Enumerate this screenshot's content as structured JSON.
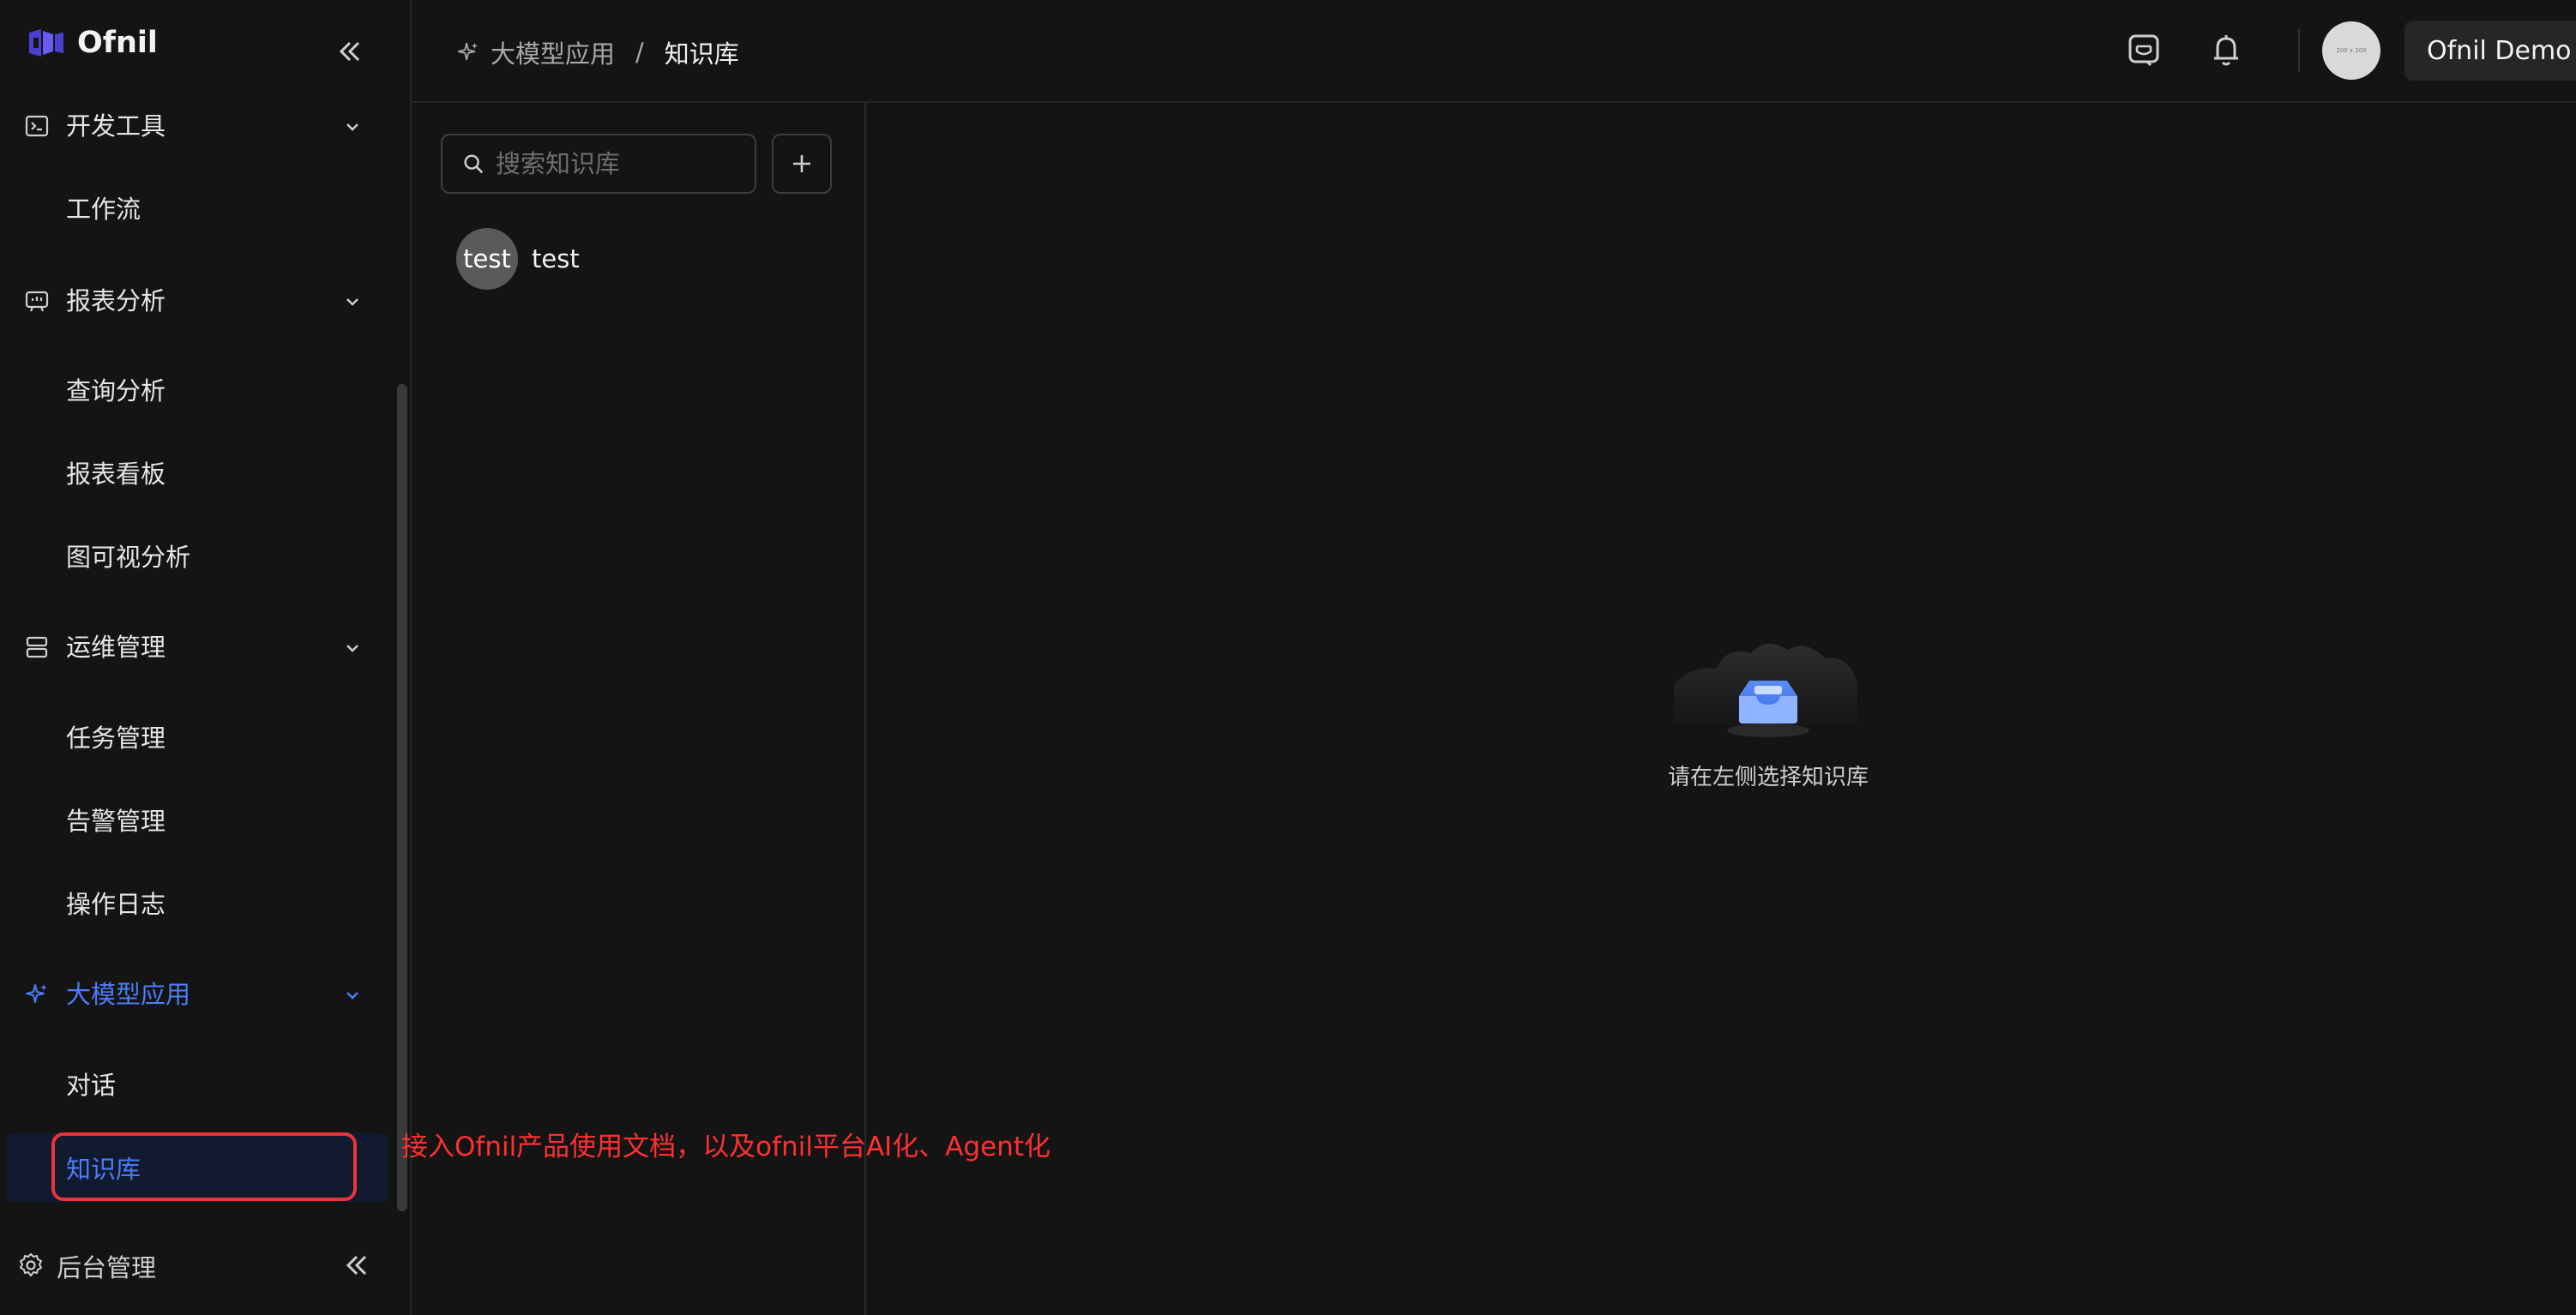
{
  "brand": {
    "name": "Ofnil"
  },
  "sidebar": {
    "groups": [
      {
        "label": "开发工具",
        "icon": "terminal-icon",
        "items": [
          {
            "label": "工作流"
          }
        ]
      },
      {
        "label": "报表分析",
        "icon": "chart-icon",
        "items": [
          {
            "label": "查询分析"
          },
          {
            "label": "报表看板"
          },
          {
            "label": "图可视分析"
          }
        ]
      },
      {
        "label": "运维管理",
        "icon": "server-icon",
        "items": [
          {
            "label": "任务管理"
          },
          {
            "label": "告警管理"
          },
          {
            "label": "操作日志"
          }
        ]
      },
      {
        "label": "大模型应用",
        "icon": "sparkle-icon",
        "items": [
          {
            "label": "对话"
          },
          {
            "label": "知识库"
          }
        ]
      }
    ],
    "footer": {
      "label": "后台管理"
    },
    "accent_color": "#4c7df7"
  },
  "header": {
    "breadcrumb": {
      "parent": "大模型应用",
      "separator": "/",
      "current": "知识库"
    },
    "account": {
      "name": "Ofnil Demo"
    },
    "avatar_text": "200 x 200"
  },
  "knowledge_base": {
    "search_placeholder": "搜索知识库",
    "items": [
      {
        "avatar": "test",
        "name": "test"
      }
    ]
  },
  "main": {
    "empty_text": "请在左侧选择知识库"
  },
  "annotation": {
    "text": "接入Ofnil产品使用文档，以及ofnil平台AI化、Agent化",
    "color": "#ff3030"
  }
}
